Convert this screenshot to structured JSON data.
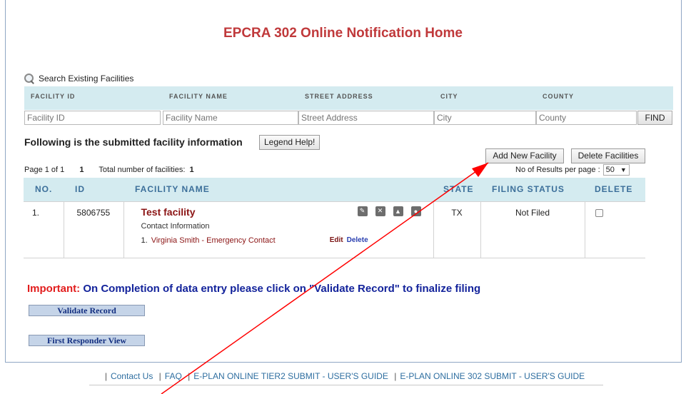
{
  "page": {
    "title": "EPCRA 302 Online Notification Home"
  },
  "search": {
    "label": "Search Existing Facilities",
    "columns": [
      "FACILITY ID",
      "FACILITY NAME",
      "STREET ADDRESS",
      "CITY",
      "COUNTY"
    ],
    "placeholders": {
      "facility_id": "Facility ID",
      "facility_name": "Facility Name",
      "street_address": "Street Address",
      "city": "City",
      "county": "County"
    },
    "find_label": "FIND"
  },
  "info": {
    "heading": "Following is the submitted facility information",
    "legend_label": "Legend Help!",
    "add_label": "Add New Facility",
    "delete_label": "Delete Facilities",
    "page_of": "Page 1 of 1",
    "page_number": "1",
    "total_label": "Total number of facilities:",
    "total_value": "1",
    "results_label": "No of Results per page :",
    "results_value": "50"
  },
  "table": {
    "headers": [
      "NO.",
      "ID",
      "FACILITY NAME",
      "STATE",
      "FILING STATUS",
      "DELETE"
    ],
    "rows": [
      {
        "no": "1.",
        "id": "5806755",
        "name": "Test facility",
        "contact_heading": "Contact Information",
        "contact_no": "1.",
        "contact_name": "Virginia Smith - Emergency Contact",
        "edit": "Edit",
        "delete": "Delete",
        "state": "TX",
        "status": "Not Filed"
      }
    ]
  },
  "notice": {
    "important": "Important:",
    "message": "On Completion of data entry please click on \"Validate Record\" to finalize filing"
  },
  "buttons": {
    "validate": "Validate Record",
    "first_responder": "First Responder View"
  },
  "footer": {
    "links": [
      "Contact Us",
      "FAQ",
      "E-PLAN ONLINE TIER2 SUBMIT - USER'S GUIDE",
      "E-PLAN ONLINE 302 SUBMIT - USER'S GUIDE"
    ]
  },
  "colors": {
    "title": "#c0393b",
    "header_bg": "#d4ebf0",
    "important": "#e21d1d",
    "message": "#13239b",
    "annotation_arrow": "#ff0000"
  }
}
